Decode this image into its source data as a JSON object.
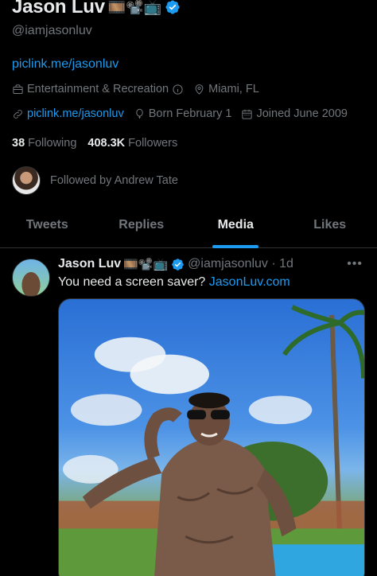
{
  "profile": {
    "name": "Jason Luv",
    "name_emojis": "🎞️📽️📺",
    "handle": "@iamjasonluv",
    "bio_link": "piclink.me/jasonluv",
    "category": "Entertainment & Recreation",
    "location": "Miami, FL",
    "website": "piclink.me/jasonluv",
    "birthday": "Born February 1",
    "joined": "Joined June 2009",
    "following_count": "38",
    "following_label": "Following",
    "followers_count": "408.3K",
    "followers_label": "Followers",
    "followed_by": "Followed by Andrew Tate"
  },
  "tabs": [
    {
      "label": "Tweets"
    },
    {
      "label": "Replies"
    },
    {
      "label": "Media"
    },
    {
      "label": "Likes"
    }
  ],
  "active_tab": "Media",
  "tweet": {
    "name": "Jason Luv",
    "emojis": "🎞️📽️📺",
    "handle_time": "@iamjasonluv · 1d",
    "more": "•••",
    "text_prefix": "You need a screen saver?",
    "text_link": "JasonLuv.com"
  },
  "colors": {
    "accent": "#1d9bf0",
    "text": "#e7e9ea",
    "muted": "#71767b",
    "background": "#000000"
  },
  "icons": [
    "verified-badge-icon",
    "briefcase-icon",
    "info-icon",
    "location-pin-icon",
    "link-icon",
    "balloon-icon",
    "calendar-icon"
  ]
}
